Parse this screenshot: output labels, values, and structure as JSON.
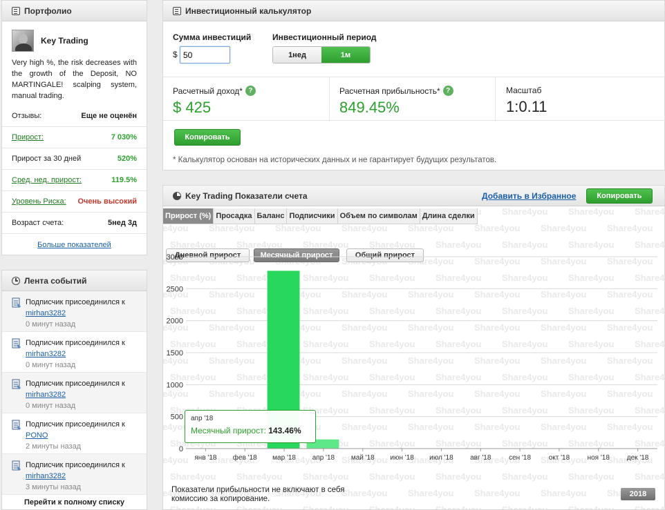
{
  "portfolio": {
    "title": "Портфолио",
    "name": "Key Trading",
    "description": "Very high %, the risk decreases with the growth of the Deposit, NO MARTINGALE! scalping system, manual trading.",
    "stats": [
      {
        "label": "Отзывы:",
        "value": "Еще не оценён",
        "link": false,
        "color": "#222222"
      },
      {
        "label": "Прирост:",
        "value": "7 030%",
        "link": true,
        "color": "#2ca02c"
      },
      {
        "label": "Прирост за 30 дней",
        "value": "520%",
        "link": false,
        "color": "#2ca02c"
      },
      {
        "label": "Сред. нед. прирост:",
        "value": "119.5%",
        "link": true,
        "color": "#2ca02c"
      },
      {
        "label": "Уровень Риска:",
        "value": "Очень высокий",
        "link": true,
        "color": "#c0392b"
      },
      {
        "label": "Возраст счета:",
        "value": "5нед 3д",
        "link": false,
        "color": "#222222"
      }
    ],
    "more_link": "Больше показателей"
  },
  "feed": {
    "title": "Лента событий",
    "events": [
      {
        "text": "Подписчик присоединился к",
        "user": "mirhan3282",
        "time": "0 минут назад"
      },
      {
        "text": "Подписчик присоединился к",
        "user": "mirhan3282",
        "time": "0 минут назад"
      },
      {
        "text": "Подписчик присоединился к",
        "user": "mirhan3282",
        "time": "0 минут назад"
      },
      {
        "text": "Подписчик присоединился к",
        "user": "PONO",
        "time": "2 минуты назад"
      },
      {
        "text": "Подписчик присоединился к",
        "user": "mirhan3282",
        "time": "3 минуты назад"
      }
    ],
    "full_list": "Перейти к полному списку"
  },
  "calculator": {
    "title": "Инвестиционный калькулятор",
    "amount_label": "Сумма инвестиций",
    "currency": "$",
    "amount_value": "50",
    "period_label": "Инвестиционный период",
    "period_options": [
      "1нед",
      "1м"
    ],
    "period_selected": 1,
    "income_label": "Расчетный доход*",
    "income_value": "$ 425",
    "profit_label": "Расчетная прибыльность*",
    "profit_value": "849.45%",
    "scale_label": "Масштаб",
    "scale_value": "1:0.11",
    "copy_button": "Копировать",
    "disclaimer": "* Калькулятор основан на исторических данных и не гарантирует будущих результатов."
  },
  "metrics": {
    "title": "Key Trading Показатели счета",
    "favorite_link": "Добавить в Избранное",
    "copy_button": "Копировать",
    "tabs": [
      "Прирост (%)",
      "Просадка",
      "Баланс",
      "Подписчики",
      "Объем по символам",
      "Длина сделки"
    ],
    "active_tab": 0,
    "subtabs": [
      "Дневной прирост",
      "Месячный прирост",
      "Общий прирост"
    ],
    "active_subtab": 1,
    "tooltip_date": "апр '18",
    "tooltip_label": "Месячный прирост:",
    "tooltip_value": "143.46%",
    "footnote": "Показатели прибыльности не включают в себя комиссию за копирование.",
    "year_badge": "2018",
    "watermark": "Share4you"
  },
  "chart_data": {
    "type": "bar",
    "categories": [
      "янв '18",
      "фев '18",
      "мар '18",
      "апр '18",
      "май '18",
      "июн '18",
      "июл '18",
      "авг '18",
      "сен '18",
      "окт '18",
      "ноя '18",
      "дек '18"
    ],
    "values": [
      0,
      0,
      2780,
      143.46,
      0,
      0,
      0,
      0,
      0,
      0,
      0,
      0
    ],
    "yticks": [
      0,
      500,
      1000,
      1500,
      2000,
      2500,
      3000
    ],
    "ylim": [
      0,
      3000
    ],
    "grid": true,
    "bar_colors": [
      "#27d85c",
      "#27d85c",
      "#27d85c",
      "#5ee88a"
    ],
    "title": "",
    "xlabel": "",
    "ylabel": ""
  }
}
